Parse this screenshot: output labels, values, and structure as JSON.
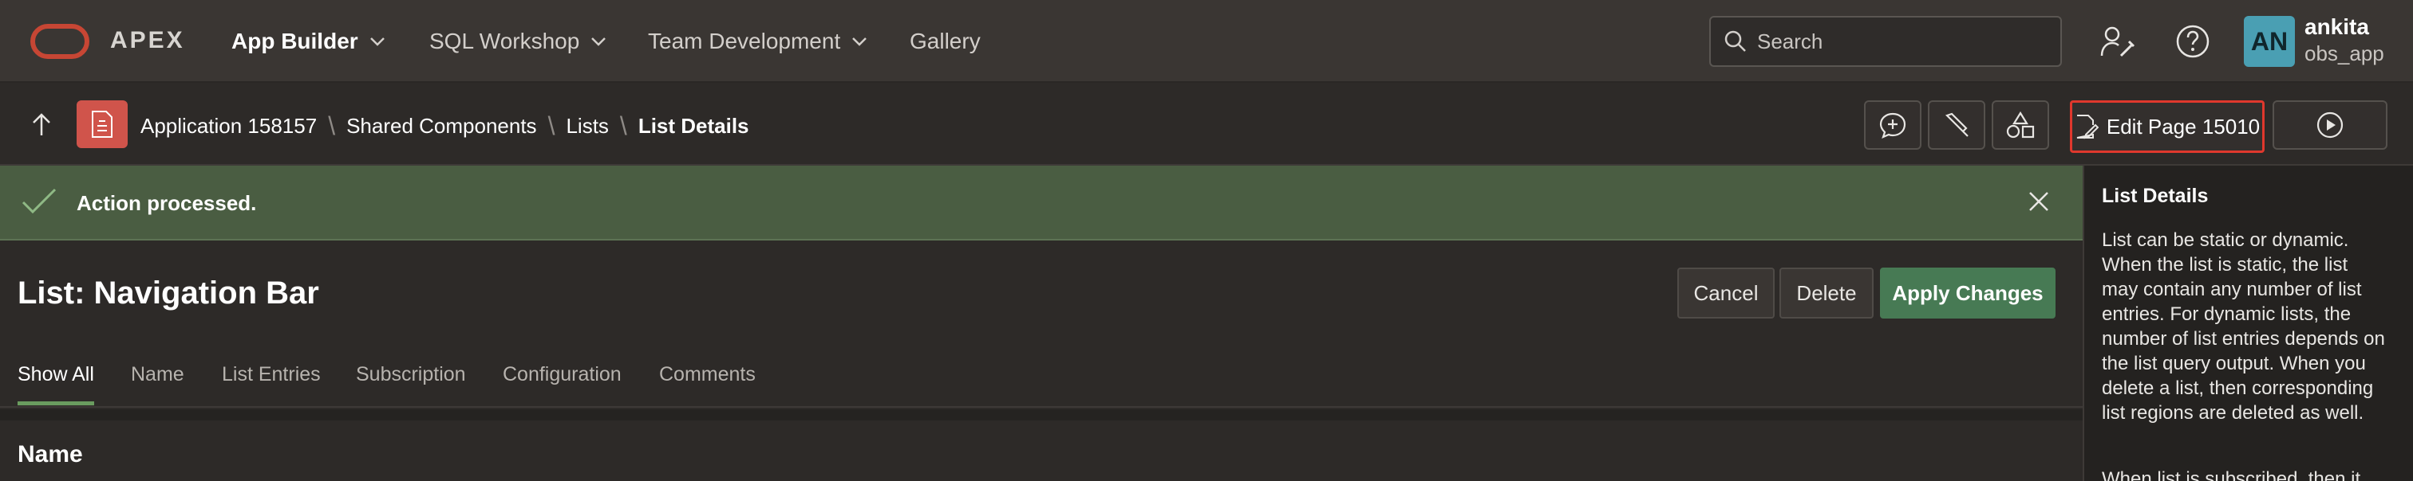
{
  "header": {
    "brand": "APEX",
    "nav": [
      {
        "label": "App Builder",
        "active": true
      },
      {
        "label": "SQL Workshop",
        "active": false
      },
      {
        "label": "Team Development",
        "active": false
      },
      {
        "label": "Gallery",
        "active": false
      }
    ],
    "search_placeholder": "Search",
    "user": {
      "initials": "AN",
      "name": "ankita",
      "workspace": "obs_app"
    },
    "avatar_color": "#4a9fb3",
    "icons": [
      "administration-icon",
      "help-icon"
    ]
  },
  "breadcrumb": {
    "items": [
      "Application 158157",
      "Shared Components",
      "Lists"
    ],
    "current": "List Details"
  },
  "toolbar": {
    "edit_page_label": "Edit Page 15010",
    "tools": [
      "comment-icon",
      "edit-tool-icon",
      "shapes-icon",
      "run-icon"
    ]
  },
  "alert": {
    "message": "Action processed.",
    "type": "success",
    "color": "#4a5d42"
  },
  "page": {
    "title": "List: Navigation Bar",
    "buttons": {
      "cancel": "Cancel",
      "delete": "Delete",
      "apply": "Apply Changes"
    },
    "tabs": [
      "Show All",
      "Name",
      "List Entries",
      "Subscription",
      "Configuration",
      "Comments"
    ],
    "active_tab": "Show All",
    "section_heading": "Name"
  },
  "help": {
    "title": "List Details",
    "body": "List can be static or dynamic. When the list is static, the list may contain any number of list entries. For dynamic lists, the number of list entries depends on the list query output. When you delete a list, then corresponding list regions are deleted as well.",
    "body_more": "When list is subscribed, then it"
  },
  "colors": {
    "accent_red": "#c74634",
    "primary_green": "#477a54",
    "highlight_box": "#e0382d"
  }
}
